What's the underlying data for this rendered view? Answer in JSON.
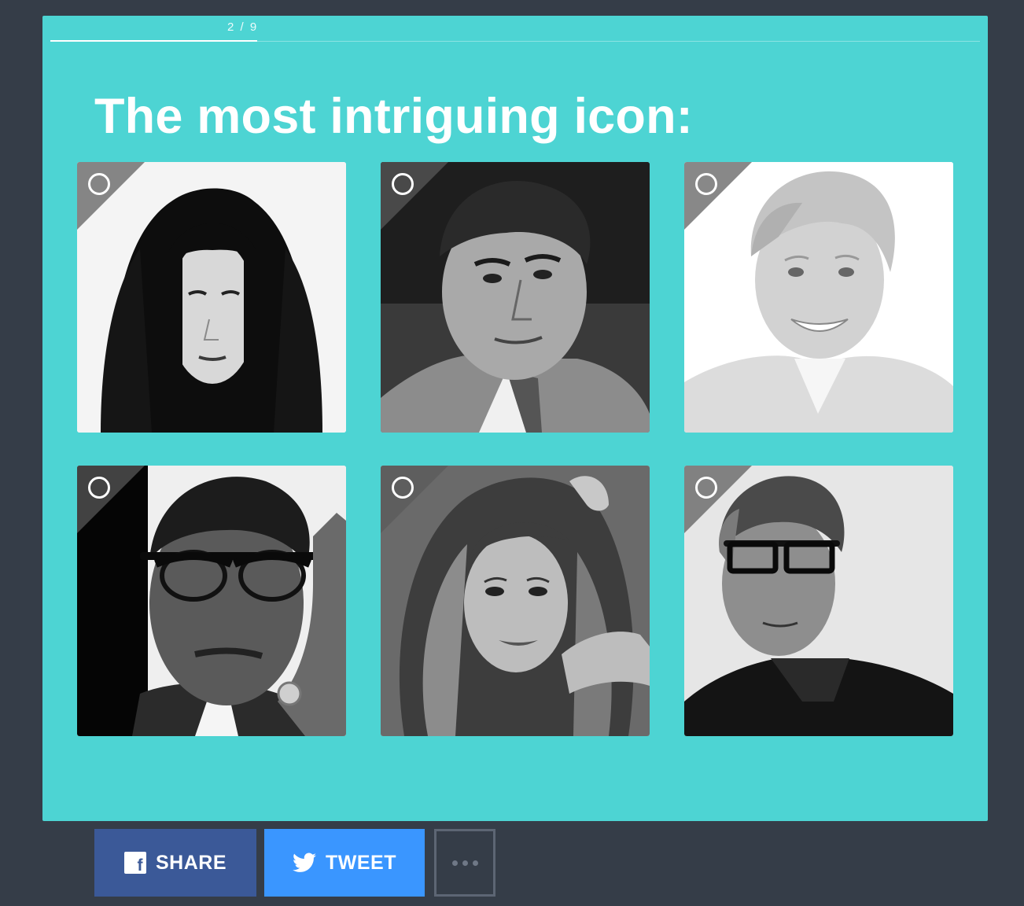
{
  "quiz": {
    "progress": {
      "current": 2,
      "total": 9,
      "label": "2 / 9",
      "fraction": 0.2222
    },
    "question": "The most intriguing icon:",
    "choices": [
      {
        "id": "choice-1",
        "image": "portrait-long-dark-hair-woman",
        "selected": false
      },
      {
        "id": "choice-2",
        "image": "portrait-man-suit-looking-up",
        "selected": false
      },
      {
        "id": "choice-3",
        "image": "portrait-smiling-woman-short-blonde-hair",
        "selected": false
      },
      {
        "id": "choice-4",
        "image": "portrait-man-browline-glasses",
        "selected": false
      },
      {
        "id": "choice-5",
        "image": "portrait-woman-long-wavy-hair",
        "selected": false
      },
      {
        "id": "choice-6",
        "image": "portrait-man-dark-glasses-gray-hair",
        "selected": false
      }
    ]
  },
  "share": {
    "facebook_label": "SHARE",
    "twitter_label": "TWEET",
    "more_icon": "ellipsis-icon"
  },
  "colors": {
    "page_background": "#353d48",
    "card_background": "#4dd4d3",
    "facebook": "#3b5998",
    "twitter": "#3a96ff"
  }
}
